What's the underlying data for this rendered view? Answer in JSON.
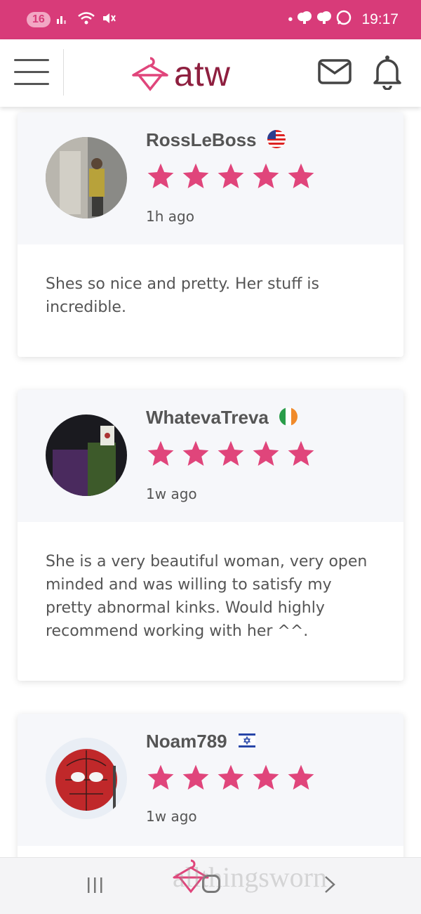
{
  "status_bar": {
    "notification_count": "16",
    "time": "19:17",
    "bg_color": "#d83b79"
  },
  "header": {
    "logo_text": "atw",
    "menu_icon": "hamburger-icon",
    "mail_icon": "mail-icon",
    "bell_icon": "bell-icon",
    "brand_color": "#8e1f3f",
    "accent_color": "#e0457b"
  },
  "reviews": [
    {
      "username": "RossLeBoss",
      "flag": "us-flag-icon",
      "rating": 5,
      "time": "1h ago",
      "text": "Shes so nice and pretty. Her stuff is incredible."
    },
    {
      "username": "WhatevaTreva",
      "flag": "ireland-flag-icon",
      "rating": 5,
      "time": "1w ago",
      "text": "She is a very beautiful woman, very open minded and was willing to satisfy my pretty abnormal kinks. Would highly recommend working with her ^^."
    },
    {
      "username": "Noam789",
      "flag": "israel-flag-icon",
      "rating": 5,
      "time": "1w ago",
      "text": ""
    }
  ],
  "bottom_nav": {
    "recents_icon": "recents-icon",
    "home_icon": "home-icon",
    "back_icon": "back-icon",
    "watermark": "allthingsworn"
  }
}
